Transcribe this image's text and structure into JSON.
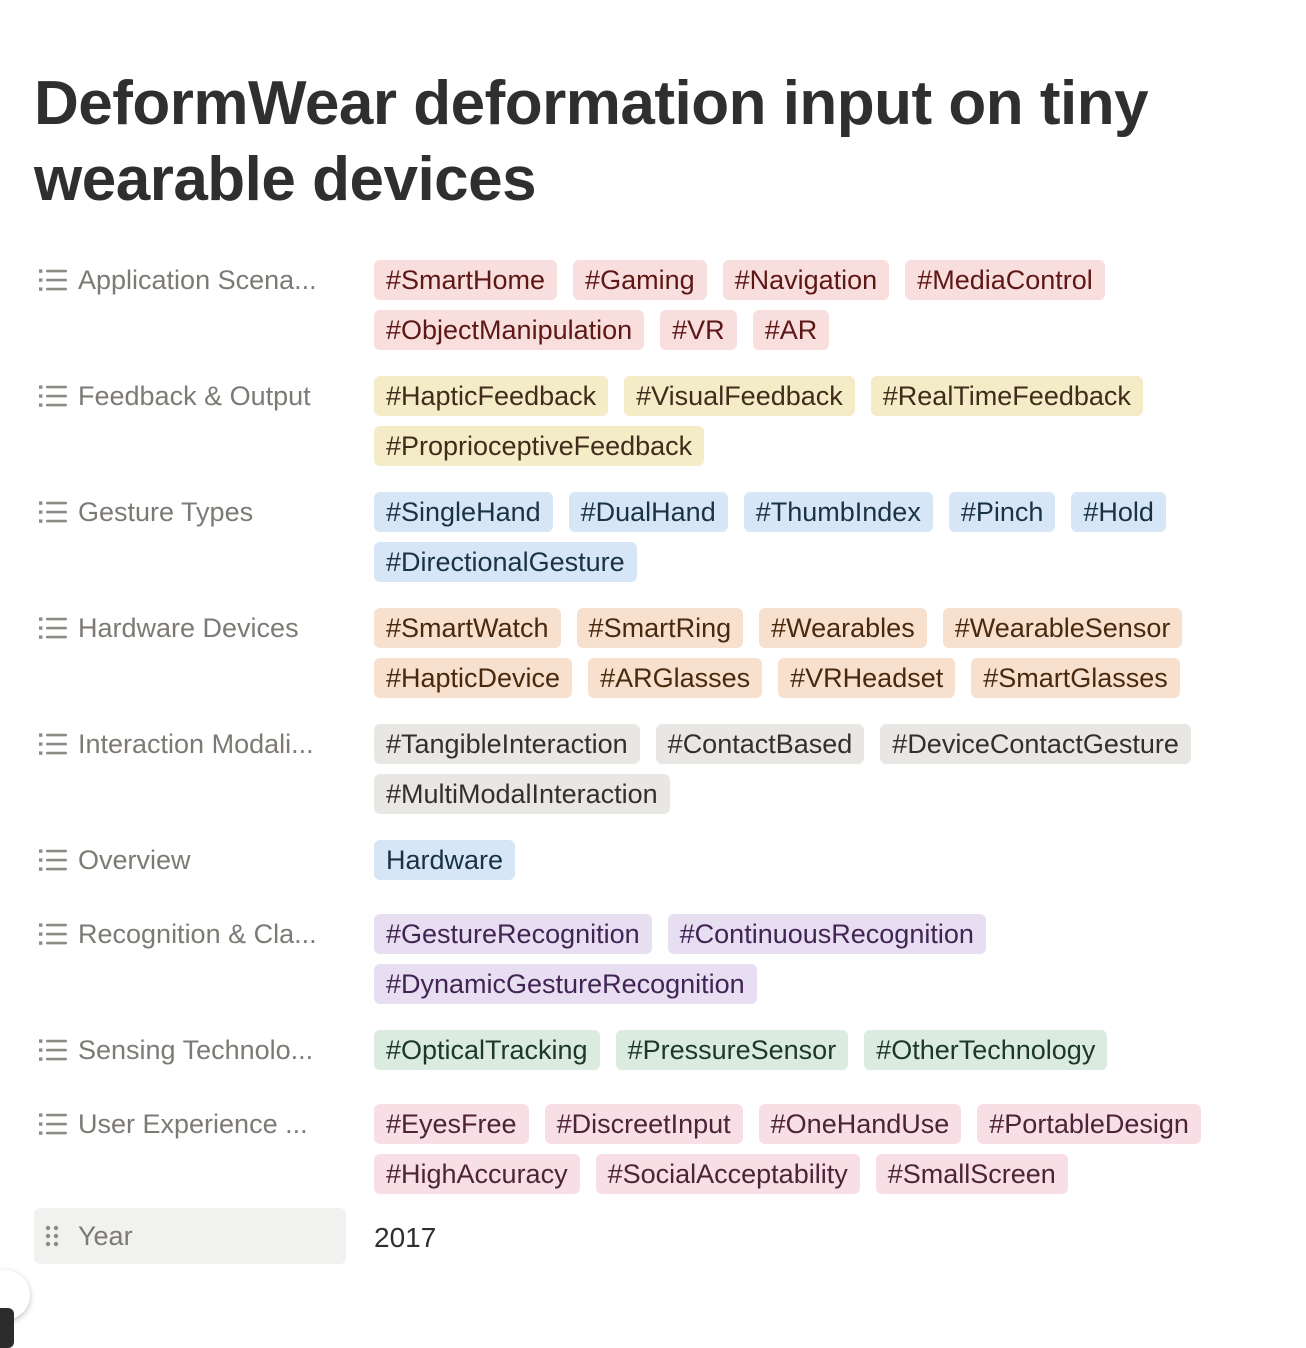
{
  "page": {
    "title": "DeformWear deformation input on tiny wearable devices"
  },
  "properties": [
    {
      "name": "Application Scena...",
      "icon": "list-icon",
      "color": "red",
      "tags": [
        "#SmartHome",
        "#Gaming",
        "#Navigation",
        "#MediaControl",
        "#ObjectManipulation",
        "#VR",
        "#AR"
      ]
    },
    {
      "name": "Feedback & Output",
      "icon": "list-icon",
      "color": "yellow",
      "tags": [
        "#HapticFeedback",
        "#VisualFeedback",
        "#RealTimeFeedback",
        "#ProprioceptiveFeedback"
      ]
    },
    {
      "name": "Gesture Types",
      "icon": "list-icon",
      "color": "blue",
      "tags": [
        "#SingleHand",
        "#DualHand",
        "#ThumbIndex",
        "#Pinch",
        "#Hold",
        "#DirectionalGesture"
      ]
    },
    {
      "name": "Hardware Devices",
      "icon": "list-icon",
      "color": "orange",
      "tags": [
        "#SmartWatch",
        "#SmartRing",
        "#Wearables",
        "#WearableSensor",
        "#HapticDevice",
        "#ARGlasses",
        "#VRHeadset",
        "#SmartGlasses"
      ]
    },
    {
      "name": "Interaction Modali...",
      "icon": "list-icon",
      "color": "gray",
      "tags": [
        "#TangibleInteraction",
        "#ContactBased",
        "#DeviceContactGesture",
        "#MultiModalInteraction"
      ]
    },
    {
      "name": "Overview",
      "icon": "list-icon",
      "color": "blue",
      "tags": [
        "Hardware"
      ]
    },
    {
      "name": "Recognition & Cla...",
      "icon": "list-icon",
      "color": "purple",
      "tags": [
        "#GestureRecognition",
        "#ContinuousRecognition",
        "#DynamicGestureRecognition"
      ]
    },
    {
      "name": "Sensing Technolo...",
      "icon": "list-icon",
      "color": "green",
      "tags": [
        "#OpticalTracking",
        "#PressureSensor",
        "#OtherTechnology"
      ]
    },
    {
      "name": "User Experience ...",
      "icon": "list-icon",
      "color": "pink",
      "tags": [
        "#EyesFree",
        "#DiscreetInput",
        "#OneHandUse",
        "#PortableDesign",
        "#HighAccuracy",
        "#SocialAcceptability",
        "#SmallScreen"
      ]
    }
  ],
  "year": {
    "name": "Year",
    "icon": "drag-handle-icon",
    "value": "2017"
  },
  "colors": {
    "red": "#f9dede",
    "yellow": "#f4ebc7",
    "blue": "#d7e6f6",
    "orange": "#f8e0cf",
    "gray": "#e8e7e4",
    "purple": "#e8def1",
    "green": "#dbebdf",
    "pink": "#f7dfe5"
  }
}
